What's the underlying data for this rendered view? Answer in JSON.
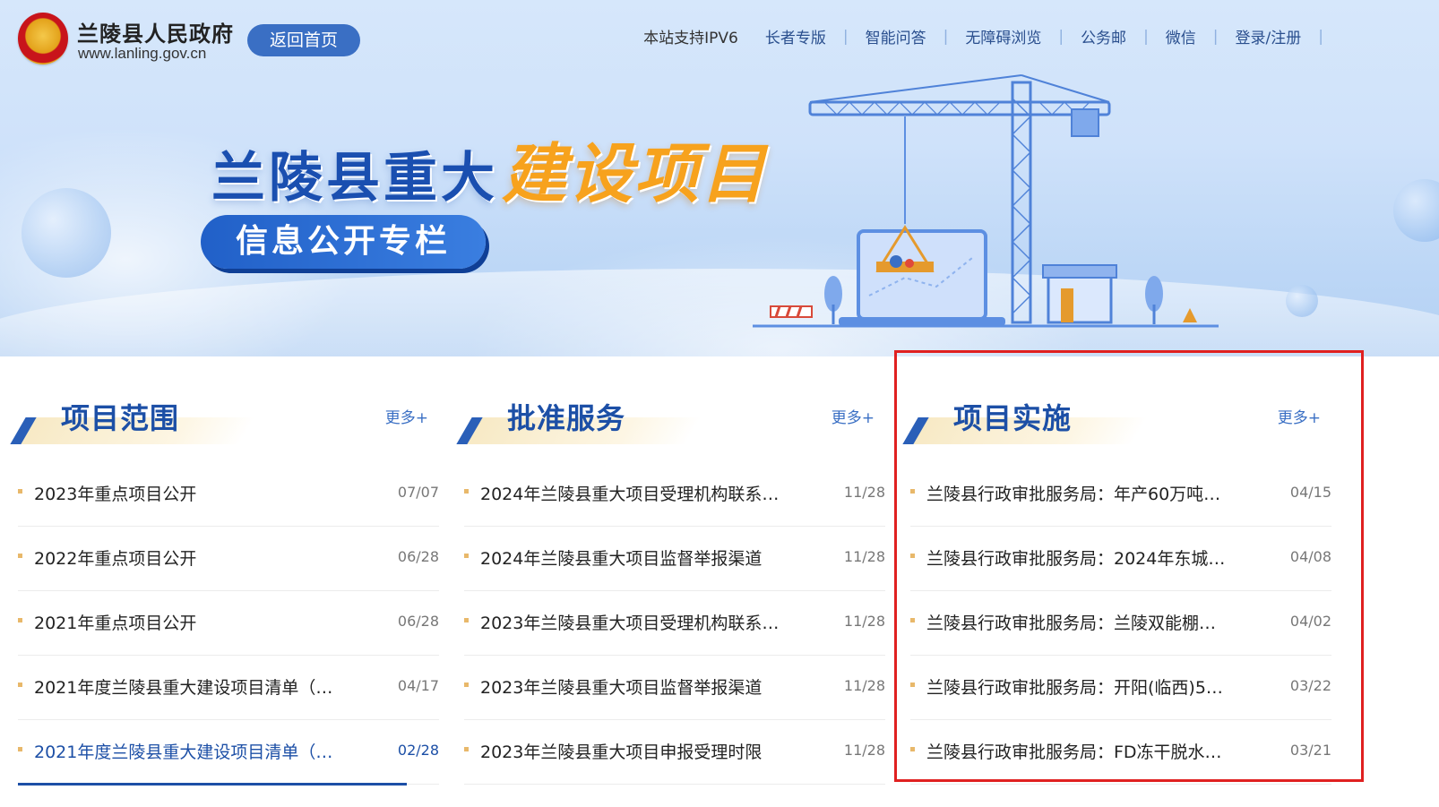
{
  "site": {
    "title": "兰陵县人民政府",
    "url": "www.lanling.gov.cn",
    "home_button": "返回首页"
  },
  "topnav": {
    "ipv6": "本站支持IPV6",
    "items": [
      "长者专版",
      "智能问答",
      "无障碍浏览",
      "公务邮",
      "微信",
      "登录/注册"
    ]
  },
  "hero": {
    "title_main": "兰陵县重大",
    "title_accent": "建设项目",
    "subtitle": "信息公开专栏"
  },
  "columns": [
    {
      "title": "项目范围",
      "more": "更多+",
      "rows": [
        {
          "text": "2023年重点项目公开",
          "date": "07/07"
        },
        {
          "text": "2022年重点项目公开",
          "date": "06/28"
        },
        {
          "text": "2021年重点项目公开",
          "date": "06/28"
        },
        {
          "text": "2021年度兰陵县重大建设项目清单（…",
          "date": "04/17"
        },
        {
          "text": "2021年度兰陵县重大建设项目清单（…",
          "date": "02/28"
        }
      ]
    },
    {
      "title": "批准服务",
      "more": "更多+",
      "rows": [
        {
          "text": "2024年兰陵县重大项目受理机构联系…",
          "date": "11/28"
        },
        {
          "text": "2024年兰陵县重大项目监督举报渠道",
          "date": "11/28"
        },
        {
          "text": "2023年兰陵县重大项目受理机构联系…",
          "date": "11/28"
        },
        {
          "text": "2023年兰陵县重大项目监督举报渠道",
          "date": "11/28"
        },
        {
          "text": "2023年兰陵县重大项目申报受理时限",
          "date": "11/28"
        }
      ]
    },
    {
      "title": "项目实施",
      "more": "更多+",
      "rows": [
        {
          "text": "兰陵县行政审批服务局：年产60万吨…",
          "date": "04/15"
        },
        {
          "text": "兰陵县行政审批服务局：2024年东城…",
          "date": "04/08"
        },
        {
          "text": "兰陵县行政审批服务局：兰陵双能棚…",
          "date": "04/02"
        },
        {
          "text": "兰陵县行政审批服务局：开阳(临西)5…",
          "date": "03/22"
        },
        {
          "text": "兰陵县行政审批服务局：FD冻干脱水…",
          "date": "03/21"
        }
      ]
    }
  ],
  "icons": [
    "national-emblem-icon",
    "tower-crane-illustration"
  ],
  "colors": {
    "brand_blue": "#1c4fa6",
    "accent_orange": "#f7a21d",
    "button_blue": "#3a6fc4",
    "highlight_red": "#e02020"
  }
}
